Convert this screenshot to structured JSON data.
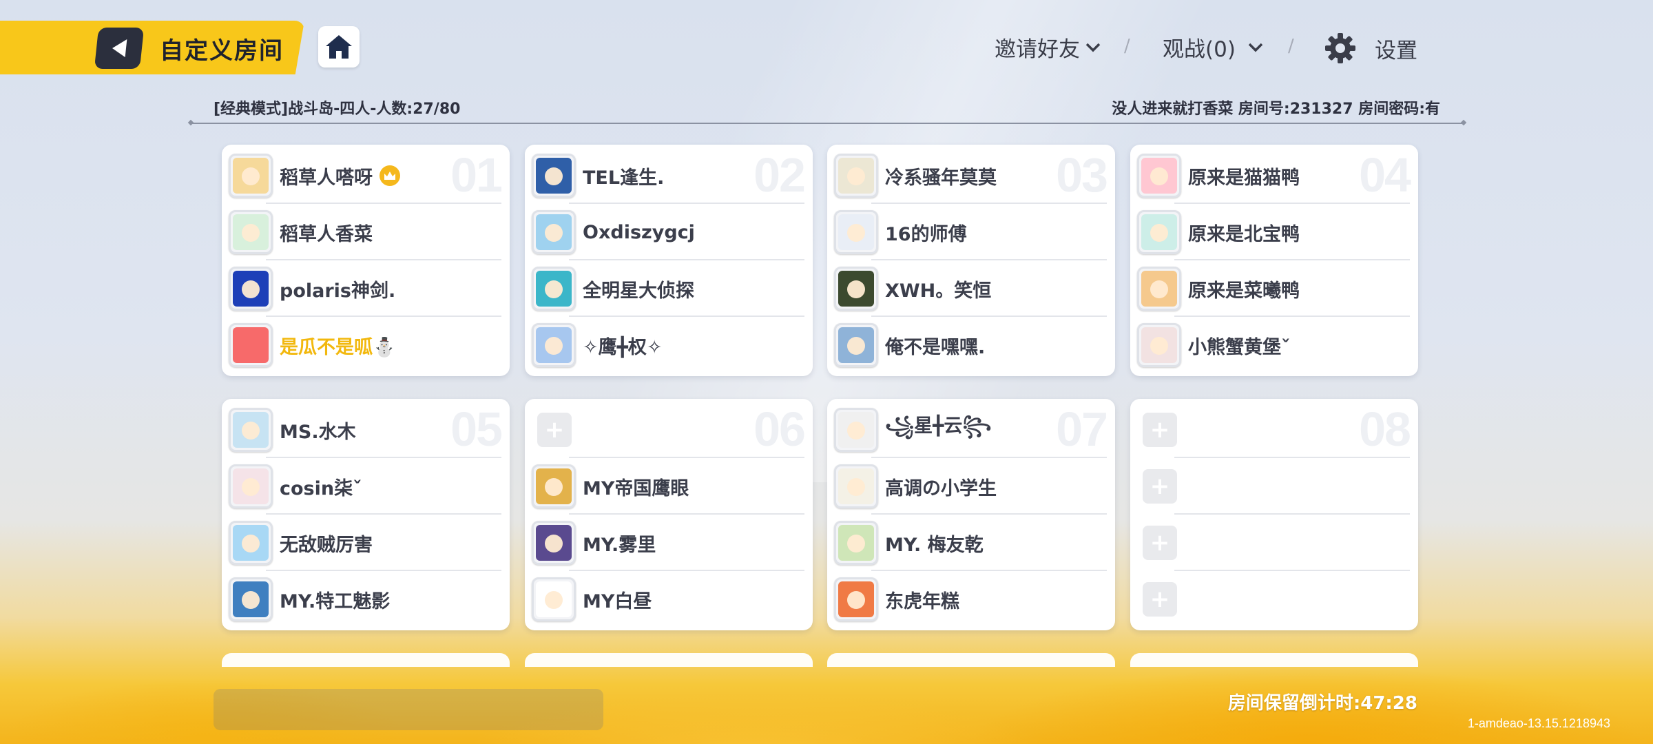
{
  "header": {
    "title": "自定义房间",
    "invite_label": "邀请好友",
    "spectate_label": "观战(0)",
    "settings_label": "设置"
  },
  "room": {
    "mode_info": "[经典模式]战斗岛-四人-人数:27/80",
    "room_info": "没人进来就打香菜 房间号:231327 房间密码:有"
  },
  "teams": [
    {
      "number": "01",
      "players": [
        {
          "name": "稻草人嗒呀",
          "color": "#f6d99a",
          "host": true
        },
        {
          "name": "稻草人香菜",
          "color": "#d8f0dc"
        },
        {
          "name": "polaris神剑.",
          "color": "#1d3fb8"
        },
        {
          "name": "是瓜不是呱⛄",
          "color": "#f76a6a",
          "highlight": true
        }
      ]
    },
    {
      "number": "02",
      "players": [
        {
          "name": "TEL逢生.",
          "color": "#2f5fa8"
        },
        {
          "name": "Oxdiszygcj",
          "color": "#9fd2ef"
        },
        {
          "name": "全明星大侦探",
          "color": "#3bb6c9"
        },
        {
          "name": "✧鹰╋权✧",
          "color": "#a7c7ef"
        }
      ]
    },
    {
      "number": "03",
      "players": [
        {
          "name": "冷系骚年莫莫",
          "color": "#ece7d4"
        },
        {
          "name": "16的师傅",
          "color": "#e9eef6"
        },
        {
          "name": "XWH。笑恒",
          "color": "#3c4a2f"
        },
        {
          "name": "俺不是嘿嘿.",
          "color": "#8fb3d8"
        }
      ]
    },
    {
      "number": "04",
      "players": [
        {
          "name": "原来是猫猫鸭",
          "color": "#ffc7d2"
        },
        {
          "name": "原来是北宝鸭",
          "color": "#cdeee8"
        },
        {
          "name": "原来是菜曦鸭",
          "color": "#f5c98d"
        },
        {
          "name": "小熊蟹黄堡ˇ",
          "color": "#f2e2e2"
        }
      ]
    },
    {
      "number": "05",
      "players": [
        {
          "name": "MS.水木",
          "color": "#c7e3f3"
        },
        {
          "name": "cosin柒ˇ",
          "color": "#f5e3e8"
        },
        {
          "name": "无敌贼厉害",
          "color": "#a8d8f5"
        },
        {
          "name": "MY.特工魅影",
          "color": "#3f7fc0"
        }
      ]
    },
    {
      "number": "06",
      "players": [
        {
          "name": "",
          "empty": true
        },
        {
          "name": "MY帝国鹰眼",
          "color": "#e3b24b"
        },
        {
          "name": "MY.雾里",
          "color": "#5a4a8f"
        },
        {
          "name": "MY白昼",
          "color": "#ffffff"
        }
      ]
    },
    {
      "number": "07",
      "players": [
        {
          "name": "꧁星╋云꧂",
          "color": "#f0f0f0"
        },
        {
          "name": "高调の小学生",
          "color": "#f4f1e6"
        },
        {
          "name": "MY. 梅友乾",
          "color": "#cfe6b8"
        },
        {
          "name": "东虎年糕",
          "color": "#f07a45"
        }
      ]
    },
    {
      "number": "08",
      "players": [
        {
          "name": "",
          "empty": true
        },
        {
          "name": "",
          "empty": true
        },
        {
          "name": "",
          "empty": true
        },
        {
          "name": "",
          "empty": true
        }
      ]
    }
  ],
  "footer": {
    "countdown": "房间保留倒计时:47:28",
    "version": "1-amdeao-13.15.1218943"
  },
  "colors": {
    "accent_yellow": "#f8c71a",
    "dark_button": "#2b2f3d",
    "host_badge": "#f5b81c"
  },
  "icons": [
    "back-arrow-icon",
    "home-icon",
    "chevron-down-icon",
    "gear-icon",
    "crown-icon",
    "plus-icon"
  ]
}
